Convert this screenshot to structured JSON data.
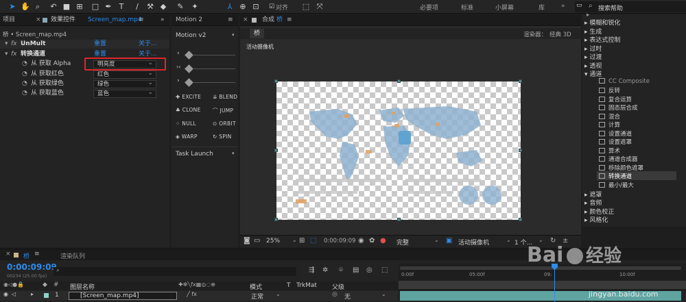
{
  "toolbar": {
    "align_label": "对齐",
    "workspaces": [
      "必要项",
      "标准",
      "小屏幕",
      "库"
    ],
    "search_placeholder": "搜索帮助"
  },
  "project_panel": {
    "tab": "项目"
  },
  "effect_controls": {
    "tab_label": "效果控件",
    "file": "Screen_map.mp4",
    "breadcrumb": "桥 • Screen_map.mp4",
    "effects": [
      {
        "name": "UnMult",
        "reset": "重置",
        "about": "关于..."
      },
      {
        "name": "转换通道",
        "reset": "重置",
        "about": "关于..."
      }
    ],
    "params": [
      {
        "label": "从 获取 Alpha",
        "value": "明亮度"
      },
      {
        "label": "从 获取红色",
        "value": "红色"
      },
      {
        "label": "从 获取绿色",
        "value": "绿色"
      },
      {
        "label": "从 获取蓝色",
        "value": "蓝色"
      }
    ]
  },
  "motion_panel": {
    "title": "Motion 2",
    "version": "Motion v2",
    "buttons": [
      "EXCITE",
      "BLEND",
      "CLONE",
      "JUMP",
      "NULL",
      "ORBIT",
      "WARP",
      "SPIN"
    ],
    "task_launch": "Task Launch"
  },
  "composition": {
    "tab_prefix": "合成",
    "tab_name": "桥",
    "sub_tab": "桥",
    "renderer_label": "渲染器：",
    "renderer_value": "经典 3D",
    "camera_label": "活动摄像机",
    "zoom": "25%",
    "timecode": "0:00:09:09",
    "resolution": "完整",
    "camera_select": "活动摄像机",
    "views": "1 个..."
  },
  "effects_tree": {
    "top_items": [
      "模糊和锐化",
      "生成",
      "表达式控制",
      "过时",
      "过渡",
      "透视",
      "通道"
    ],
    "channel_items": [
      "CC Composite",
      "反转",
      "复合运算",
      "固态层合成",
      "混合",
      "计算",
      "设置通道",
      "设置遮罩",
      "算术",
      "通道合成器",
      "移除颜色遮罩",
      "转换通道",
      "最小/最大"
    ],
    "bottom_items": [
      "遮罩",
      "音频",
      "颜色校正",
      "风格化"
    ]
  },
  "timeline": {
    "comp_tab": "桥",
    "render_queue": "渲染队列",
    "timecode": "0:00:09:09",
    "frame_info": "00234 (25.00 fps)",
    "col_layer_name": "图层名称",
    "col_mode": "模式",
    "col_trkmat": "TrkMat",
    "col_parent": "父级",
    "layer_index": "1",
    "layer_name": "[Screen_map.mp4]",
    "layer_mode": "正常",
    "layer_parent": "无",
    "ruler": [
      "0:00f",
      "05:00f",
      "09:",
      "10:00f"
    ]
  },
  "watermark": {
    "domain": "jingyan.baidu.com"
  },
  "colors": {
    "accent": "#2d8ceb",
    "highlight_box": "#e0262b",
    "playhead": "#2d8ceb"
  }
}
